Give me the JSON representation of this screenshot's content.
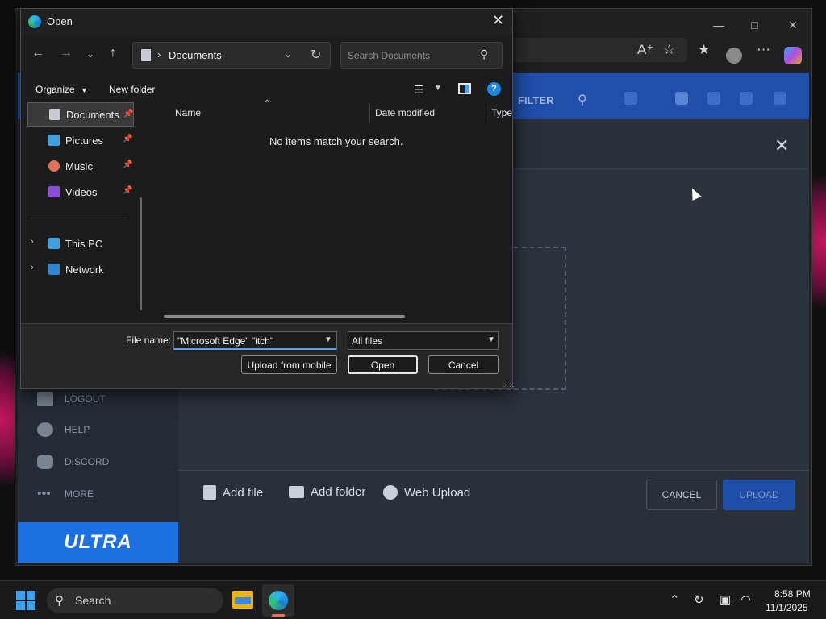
{
  "dialog": {
    "title": "Open",
    "breadcrumb_folder": "Documents",
    "search_placeholder": "Search Documents",
    "organize_label": "Organize",
    "new_folder_label": "New folder",
    "nav_items": [
      {
        "label": "Documents",
        "icon": "documents-icon",
        "color": "#c8cdd3"
      },
      {
        "label": "Pictures",
        "icon": "pictures-icon",
        "color": "#3fa0e0"
      },
      {
        "label": "Music",
        "icon": "music-icon",
        "color": "#e0705a"
      },
      {
        "label": "Videos",
        "icon": "videos-icon",
        "color": "#8a4fd6"
      }
    ],
    "tree_items": [
      {
        "label": "This PC",
        "icon": "this-pc-icon"
      },
      {
        "label": "Network",
        "icon": "network-icon"
      }
    ],
    "columns": [
      "Name",
      "Date modified",
      "Type"
    ],
    "empty_message": "No items match your search.",
    "file_name_label": "File name:",
    "file_name_value": "\"Microsoft Edge\" \"itch\"",
    "file_type_value": "All files",
    "upload_mobile_label": "Upload from mobile",
    "open_label": "Open",
    "cancel_label": "Cancel"
  },
  "app": {
    "filter_label": "FILTER",
    "sidebar": [
      {
        "label": "LOGOUT",
        "icon": "logout-icon"
      },
      {
        "label": "HELP",
        "icon": "help-icon"
      },
      {
        "label": "DISCORD",
        "icon": "discord-icon"
      },
      {
        "label": "MORE",
        "icon": "more-icon"
      }
    ],
    "brand": "ULTRA",
    "bottom_actions": [
      {
        "label": "Add file",
        "icon": "add-file-icon"
      },
      {
        "label": "Add folder",
        "icon": "add-folder-icon"
      },
      {
        "label": "Web Upload",
        "icon": "globe-icon"
      }
    ],
    "cancel_label": "CANCEL",
    "upload_label": "UPLOAD"
  },
  "taskbar": {
    "search_label": "Search",
    "time": "8:58 PM",
    "date": "11/1/2025"
  },
  "colors": {
    "accent": "#1a8ae6",
    "app_blue": "#1f4fa8",
    "brand_blue": "#1e6fe0"
  }
}
